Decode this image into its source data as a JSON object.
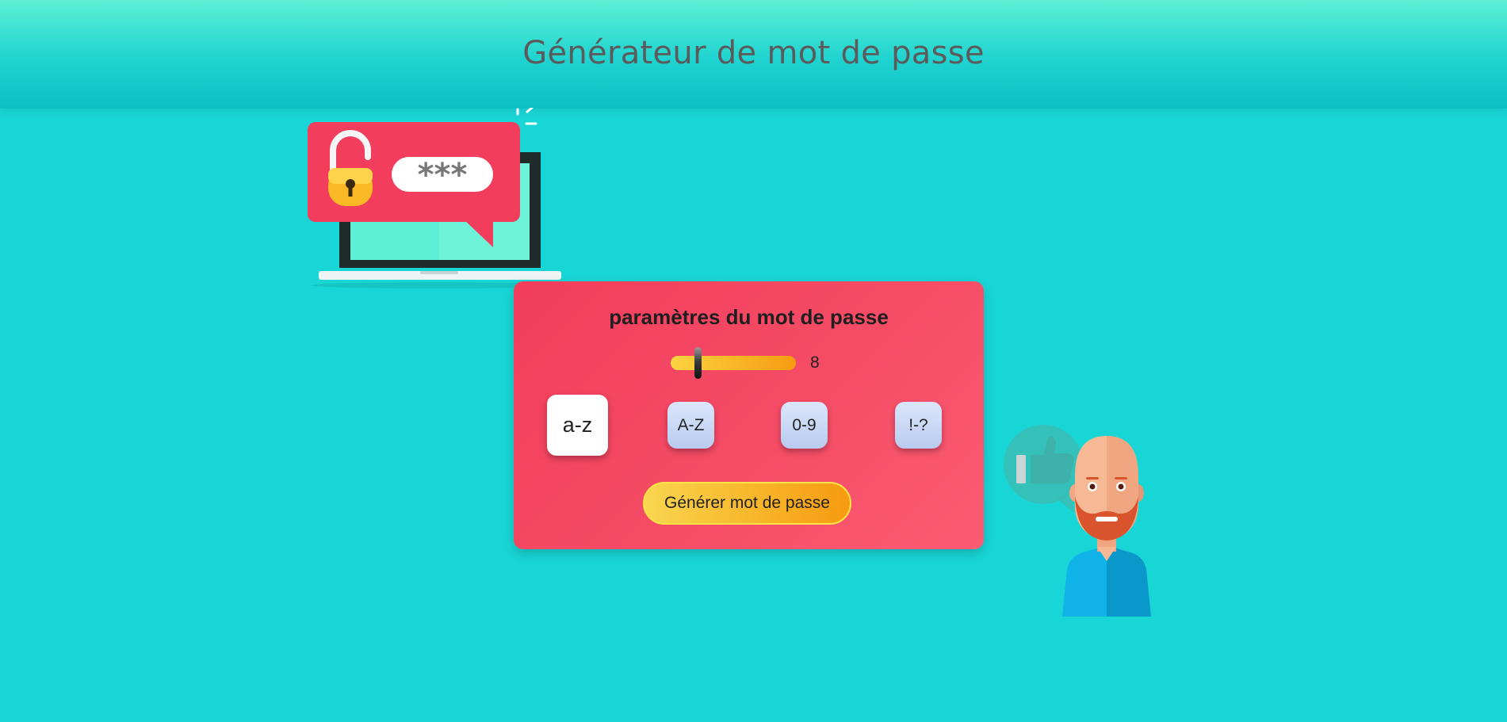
{
  "header": {
    "title": "Générateur de mot de passe"
  },
  "illustrations": {
    "laptop_password_text": "***"
  },
  "panel": {
    "title": "paramètres du mot de passe",
    "length": {
      "value": "8"
    },
    "options": [
      {
        "label": "a-z",
        "active": true
      },
      {
        "label": "A-Z",
        "active": false
      },
      {
        "label": "0-9",
        "active": false
      },
      {
        "label": "!-?",
        "active": false
      }
    ],
    "generate_label": "Générer mot de passe"
  },
  "colors": {
    "background": "#19d6d6",
    "panel": "#f54c66",
    "accent": "#f8b227"
  }
}
